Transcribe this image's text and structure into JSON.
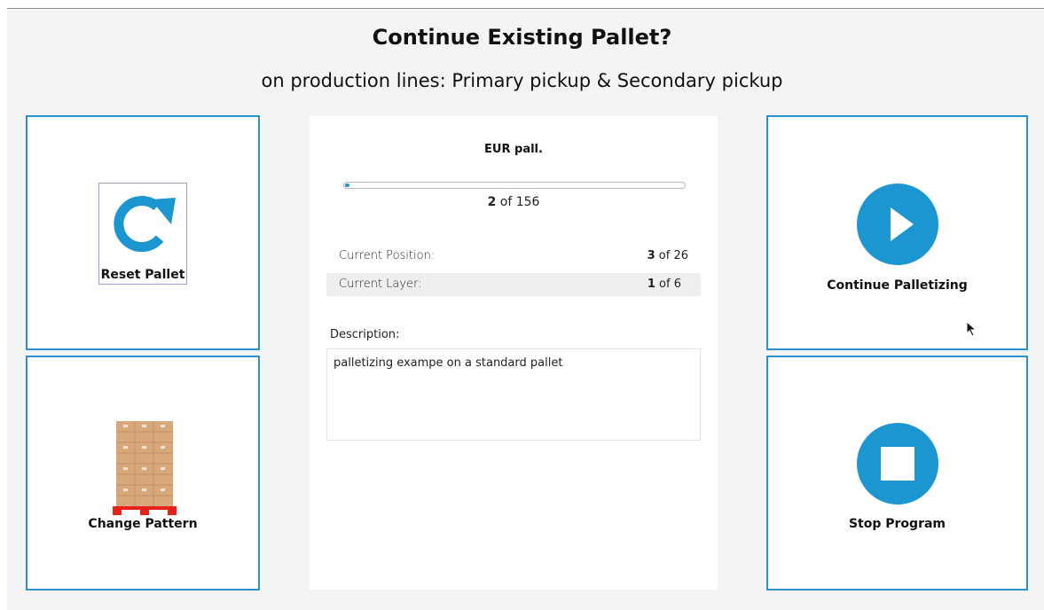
{
  "header": {
    "title": "Continue Existing Pallet?",
    "subtitle": "on production lines: Primary pickup & Secondary pickup"
  },
  "actions": {
    "reset_label": "Reset Pallet",
    "change_pattern_label": "Change Pattern",
    "continue_label": "Continue Palletizing",
    "stop_label": "Stop Program"
  },
  "pallet": {
    "name": "EUR pall.",
    "progress_fraction": 0.0128,
    "progress_current": "2",
    "progress_total_text": " of 156",
    "position_label": "Current Position:",
    "position_current": "3",
    "position_total_text": " of 26",
    "layer_label": "Current Layer:",
    "layer_current": "1",
    "layer_total_text": " of 6",
    "description_label": "Description:",
    "description": "palletizing exampe on a standard pallet"
  },
  "colors": {
    "accent": "#1c96d1",
    "tile_border": "#2b92c9",
    "pallet_red": "#e8221a",
    "box": "#d9a87a"
  },
  "icons": {
    "reset": "refresh-arrow-icon",
    "pattern": "pallet-stack-icon",
    "continue": "play-icon",
    "stop": "stop-icon"
  }
}
